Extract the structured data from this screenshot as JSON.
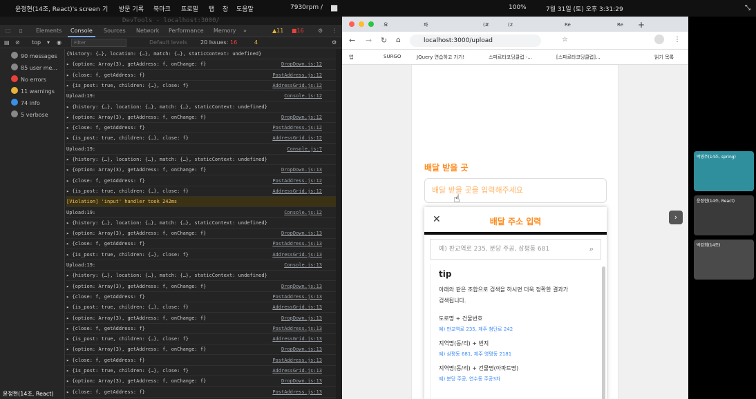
{
  "top_bar": {
    "screen_label": "윤정현(14조, React)'s screen",
    "menu_items": [
      "기",
      "방문 기록",
      "북마크",
      "프로필",
      "탭",
      "창",
      "도움말"
    ],
    "cpu": "7930rpm /",
    "clock": "7월 31일 (토) 오후 3:31:29",
    "battery": "100%"
  },
  "devtools": {
    "title": "DevTools - localhost:3000/",
    "tabs": [
      "Elements",
      "Console",
      "Sources",
      "Network",
      "Performance",
      "Memory"
    ],
    "active_tab": "Console",
    "warnings_badge": "11",
    "errors_badge": "16",
    "issues_badge": "4",
    "toolbar": {
      "context": "top",
      "filter_placeholder": "Filter",
      "levels": "Default levels",
      "issues": "20 Issues:",
      "issue_err": "16",
      "issue_warn": "4"
    },
    "sidebar": [
      {
        "label": "90 messages",
        "color": "#888"
      },
      {
        "label": "85 user me...",
        "color": "#888"
      },
      {
        "label": "No errors",
        "color": "#e8403a"
      },
      {
        "label": "11 warnings",
        "color": "#e8b33a"
      },
      {
        "label": "74 info",
        "color": "#3a8ee8"
      },
      {
        "label": "5 verbose",
        "color": "#888"
      }
    ],
    "logs": [
      {
        "text": "{history: {…}, location: {…}, match: {…}, staticContext: undefined}",
        "src": "",
        "kind": "normal"
      },
      {
        "text": "▸ {option: Array(3), getAddress: f, onChange: f}",
        "src": "DropDown.js:12",
        "kind": "normal"
      },
      {
        "text": "▸ {close: f, getAddress: f}",
        "src": "PostAddress.js:12",
        "kind": "normal"
      },
      {
        "text": "▸ {is_post: true, children: {…}, close: f}",
        "src": "AddressGrid.js:12",
        "kind": "normal"
      },
      {
        "text": "Upload:19:",
        "src": "Console.js:12",
        "kind": "normal"
      },
      {
        "text": "▸ {history: {…}, location: {…}, match: {…}, staticContext: undefined}",
        "src": "",
        "kind": "normal"
      },
      {
        "text": "▸ {option: Array(3), getAddress: f, onChange: f}",
        "src": "DropDown.js:12",
        "kind": "normal"
      },
      {
        "text": "▸ {close: f, getAddress: f}",
        "src": "PostAddress.js:12",
        "kind": "normal"
      },
      {
        "text": "▸ {is_post: true, children: {…}, close: f}",
        "src": "AddressGrid.js:12",
        "kind": "normal"
      },
      {
        "text": "Upload:19:",
        "src": "Console.js:7",
        "kind": "normal"
      },
      {
        "text": "▸ {history: {…}, location: {…}, match: {…}, staticContext: undefined}",
        "src": "",
        "kind": "normal"
      },
      {
        "text": "▸ {option: Array(3), getAddress: f, onChange: f}",
        "src": "DropDown.js:13",
        "kind": "normal"
      },
      {
        "text": "▸ {close: f, getAddress: f}",
        "src": "PostAddress.js:12",
        "kind": "normal"
      },
      {
        "text": "▸ {is_post: true, children: {…}, close: f}",
        "src": "AddressGrid.js:12",
        "kind": "normal"
      },
      {
        "text": "[Violation] 'input' handler took 242ms",
        "src": "",
        "kind": "violation"
      },
      {
        "text": "Upload:19:",
        "src": "Console.js:12",
        "kind": "normal"
      },
      {
        "text": "▸ {history: {…}, location: {…}, match: {…}, staticContext: undefined}",
        "src": "",
        "kind": "normal"
      },
      {
        "text": "▸ {option: Array(3), getAddress: f, onChange: f}",
        "src": "DropDown.js:13",
        "kind": "normal"
      },
      {
        "text": "▸ {close: f, getAddress: f}",
        "src": "PostAddress.js:13",
        "kind": "normal"
      },
      {
        "text": "▸ {is_post: true, children: {…}, close: f}",
        "src": "AddressGrid.js:13",
        "kind": "normal"
      },
      {
        "text": "Upload:19:",
        "src": "Console.js:13",
        "kind": "normal"
      },
      {
        "text": "▸ {history: {…}, location: {…}, match: {…}, staticContext: undefined}",
        "src": "",
        "kind": "normal"
      },
      {
        "text": "▸ {option: Array(3), getAddress: f, onChange: f}",
        "src": "DropDown.js:13",
        "kind": "normal"
      },
      {
        "text": "▸ {close: f, getAddress: f}",
        "src": "PostAddress.js:13",
        "kind": "normal"
      },
      {
        "text": "▸ {is_post: true, children: {…}, close: f}",
        "src": "AddressGrid.js:13",
        "kind": "normal"
      },
      {
        "text": "▸ {option: Array(3), getAddress: f, onChange: f}",
        "src": "DropDown.js:13",
        "kind": "normal"
      },
      {
        "text": "▸ {close: f, getAddress: f}",
        "src": "PostAddress.js:13",
        "kind": "normal"
      },
      {
        "text": "▸ {is_post: true, children: {…}, close: f}",
        "src": "AddressGrid.js:13",
        "kind": "normal"
      },
      {
        "text": "▸ {option: Array(3), getAddress: f, onChange: f}",
        "src": "DropDown.js:13",
        "kind": "normal"
      },
      {
        "text": "▸ {close: f, getAddress: f}",
        "src": "PostAddress.js:13",
        "kind": "normal"
      },
      {
        "text": "▸ {is_post: true, children: {…}, close: f}",
        "src": "AddressGrid.js:13",
        "kind": "normal"
      },
      {
        "text": "▸ {option: Array(3), getAddress: f, onChange: f}",
        "src": "DropDown.js:13",
        "kind": "normal"
      },
      {
        "text": "▸ {close: f, getAddress: f}",
        "src": "PostAddress.js:13",
        "kind": "normal"
      },
      {
        "text": "▸ {is_post: true, children: {…}, close: f}",
        "src": "AddressGrid.js:13",
        "kind": "normal"
      }
    ],
    "presenter_name": "윤정현(14조, React)"
  },
  "browser": {
    "tabs": [
      "요",
      "파",
      "(#",
      "(2",
      "Re",
      "Re"
    ],
    "url": "localhost:3000/upload",
    "bookmarks": [
      "앱",
      "SURGO",
      "JQuery 연습하고 가기!",
      "스파르타코딩클럽 -...",
      "[스파르타코딩클럽]...",
      "읽기 목록"
    ],
    "page": {
      "section_label": "배달 받을 곳",
      "address_placeholder": "배달 받을 곳을 입력해주세요",
      "modal_title": "배달 주소 입력",
      "search_placeholder": "예) 판교역로 235, 분당 주공, 삼평동 681",
      "tip_title": "tip",
      "tip_text_1": "아래와 같은 조합으로 검색을 하시면 더욱 정확한 결과가",
      "tip_text_2": "검색됩니다.",
      "combo_1": "도로명 + 건물번호",
      "combo_1_ex": "예) 판교역로 235,  제주 첨단로 242",
      "combo_2": "지역명(동/리) + 번지",
      "combo_2_ex": "예) 삼평동 681,  제주 영평동 2181",
      "combo_3": "지역명(동/리) + 건물명(아파트명)",
      "combo_3_ex": "예) 분당 주공,  연수동 주공3차"
    },
    "accent_color": "#ff8a1c"
  },
  "participants": [
    {
      "name": "박영주(14조, spring)",
      "bg": "#2f8f9d"
    },
    {
      "name": "윤정현(14조, React)",
      "bg": "#3a3a3a"
    },
    {
      "name": "박강희(14조)",
      "bg": "#4a4a4a"
    }
  ]
}
